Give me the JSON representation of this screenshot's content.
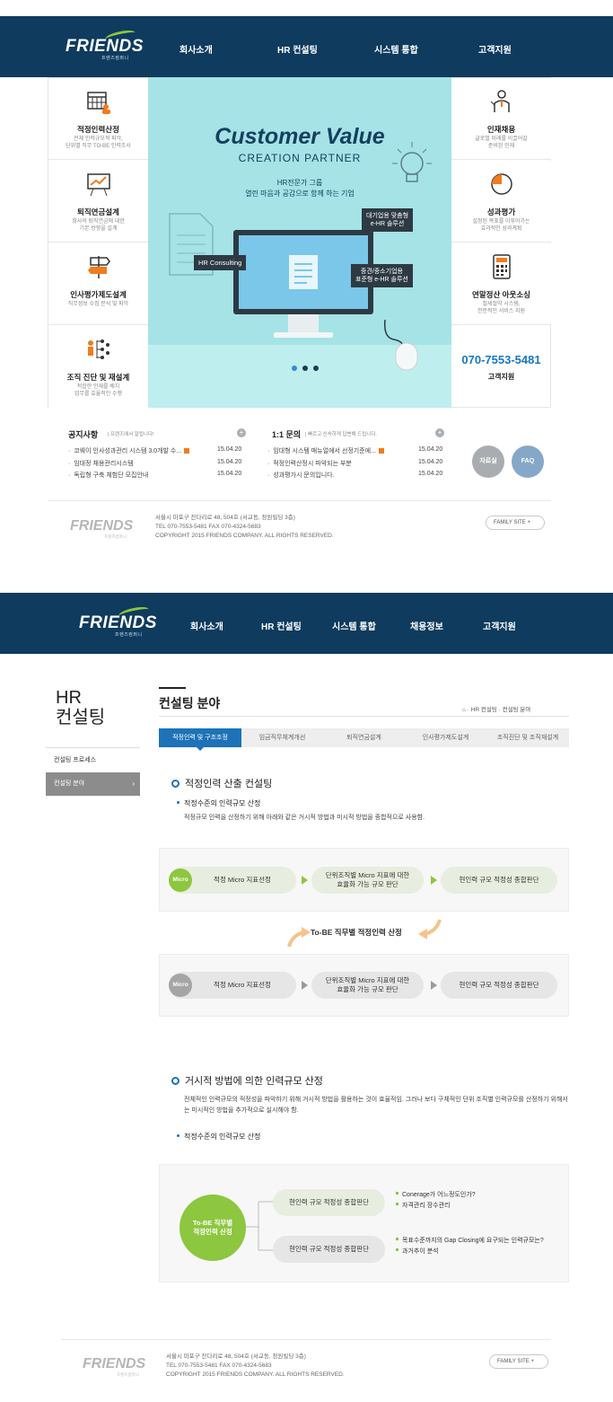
{
  "colors": {
    "navy": "#0e3b5e",
    "accent_blue": "#1d72b8",
    "green": "#8dc63f",
    "hero_bg": "#a5e3e6",
    "orange": "#f07c1f"
  },
  "page1": {
    "logo": "FRIENDS",
    "logo_sub": "프렌즈컴퍼니",
    "nav": [
      "회사소개",
      "HR 컨설팅",
      "시스템 통합",
      "고객지원"
    ],
    "left_services": [
      {
        "title": "적정인력산정",
        "desc": "전체 인력규모적 파악,\n단위별 직무 TO-BE 인력조사",
        "icon": "calendar-person-icon"
      },
      {
        "title": "퇴직연금설계",
        "desc": "회사의 퇴직연금에 대한\n기본 방향을 설계",
        "icon": "chart-board-icon"
      },
      {
        "title": "인사평가제도설계",
        "desc": "직무정보 수집 분석 및 파악",
        "icon": "signpost-icon"
      },
      {
        "title": "조직 진단 및 재설계",
        "desc": "적합한 인재를 배치\n업무를 효율적인 수행",
        "icon": "org-chart-icon"
      }
    ],
    "right_services": [
      {
        "title": "인재채용",
        "desc": "글로벌 미래를 이끌어갈\n준비된 인재",
        "icon": "presenter-icon"
      },
      {
        "title": "성과평가",
        "desc": "설정된 목표를 이루어가는\n효과적인 성과계획",
        "icon": "pie-chart-icon"
      },
      {
        "title": "연말정산 아웃소싱",
        "desc": "절세절약 시스템,\n전문적인 서비스 지원",
        "icon": "calculator-icon"
      }
    ],
    "hero": {
      "title": "Customer Value",
      "subtitle": "CREATION PARTNER",
      "tagline1": "HR전문가 그룹",
      "tagline2": "열린 마음과 공감으로 함께 하는 기업",
      "bubble_left": "HR Consulting",
      "bubble_top": "대기업용 맞춤형\ne-HR 솔루션",
      "bubble_right": "중견/중소기업용\n표준형 e-HR 솔루션"
    },
    "phone": "070-7553-5481",
    "phone_label": "고객지원",
    "notice": {
      "title": "공지사항",
      "sub": "프렌즈에서 알립니다!",
      "rows": [
        {
          "text": "코웨이 인사성과관리 시스템 3.0개발 수...",
          "date": "15.04.20",
          "new": true
        },
        {
          "text": "임대정 채용관리시스템",
          "date": "15.04.20",
          "new": false
        },
        {
          "text": "독립형 구축 체험단 모집안내",
          "date": "15.04.20",
          "new": false
        }
      ]
    },
    "qa": {
      "title": "1:1 문의",
      "sub": "빠르고 신속하게 답변해 드립니다.",
      "rows": [
        {
          "text": "임대형 시스템 매뉴얼에서 선정기준에...",
          "date": "15.04.20",
          "new": true
        },
        {
          "text": "적정인력산정시 파악되는 부분",
          "date": "15.04.20",
          "new": false
        },
        {
          "text": "성과평가시 문의입니다.",
          "date": "15.04.20",
          "new": false
        }
      ]
    },
    "btn_files": "자료실",
    "btn_faq": "FAQ",
    "footer": {
      "logo": "FRIENDS",
      "logo_sub": "프렌즈컴퍼니",
      "addr1": "서울시 마포구 잔다리로 48, 504호 (서교동, 정원빌딩 3층)",
      "addr2": "TEL 070-7553-5481  FAX 070-4324-5683",
      "addr3": "COPYRIGHT 2015 FRIENDS COMPANY. ALL RIGHTS RESERVED.",
      "family": "FAMILY SITE  +"
    }
  },
  "page2": {
    "logo": "FRIENDS",
    "logo_sub": "프렌즈컴퍼니",
    "nav": [
      "회사소개",
      "HR 컨설팅",
      "시스템 통합",
      "채용정보",
      "고객지원"
    ],
    "lnb_title_1": "HR",
    "lnb_title_2": "컨설팅",
    "lnb_items": [
      "컨설팅 프로세스",
      "컨설팅 분야"
    ],
    "page_title": "컨설팅 분야",
    "breadcrumb": "⌂  ·  HR 컨설팅  ·  컨설팅 분야",
    "tabs": [
      "적정인력 및 구조조정",
      "임금직무체계개선",
      "퇴직연금설계",
      "인사평가제도설계",
      "조직진단 및 조직재설계"
    ],
    "section1": {
      "heading": "적정인력 산출 컨설팅",
      "sub": "적정수준의 인력규모 산정",
      "desc": "적정규모 인력을 산정하기 위해 아래와 같은 거시적 방법과 미시적 방법을 종합적으로 사용함.",
      "micro": "Micro",
      "step1": "적정 Micro 지표선정",
      "step2": "단위조직별 Micro 지표에 대한\n효율화 가능 규모 판단",
      "step3": "현인력 규모 적정성 종합판단",
      "mid_label": "To-BE 직무별 적정인력 산정"
    },
    "section2": {
      "heading": "거시적 방법에 의한 인력규모 산정",
      "desc": "전체적인 인력규모의 적정성을 파악하기 위해 거시적 방법을 활용하는 것이 효율적임. 그러나 보다 구체적인 단위 조직별 인력규모를 산정하기 위해서는 미시적인 방법을 추가적으로 실시해야 함.",
      "sub": "적정수준의 인력규모 산정",
      "circle": "To-BE 직무별\n적정인력 산정",
      "pill1": "현인력 규모 적정성 종합판단",
      "pill2": "현인력 규모 적정성 종합판단",
      "note1a": "Conerage가 어느정도인가?",
      "note1b": "자격관리 장수관리",
      "note2a": "목표수준까지의 Gap Closing에 요구되는 인력규모는?",
      "note2b": "과거추이 분석"
    },
    "footer": {
      "logo": "FRIENDS",
      "logo_sub": "프렌즈컴퍼니",
      "addr1": "서울시 마포구 잔다리로 48, 504호 (서교동, 정원빌딩 3층)",
      "addr2": "TEL 070-7553-5481  FAX 070-4324-5683",
      "addr3": "COPYRIGHT 2015 FRIENDS COMPANY. ALL RIGHTS RESERVED.",
      "family": "FAMILY SITE  +"
    }
  }
}
